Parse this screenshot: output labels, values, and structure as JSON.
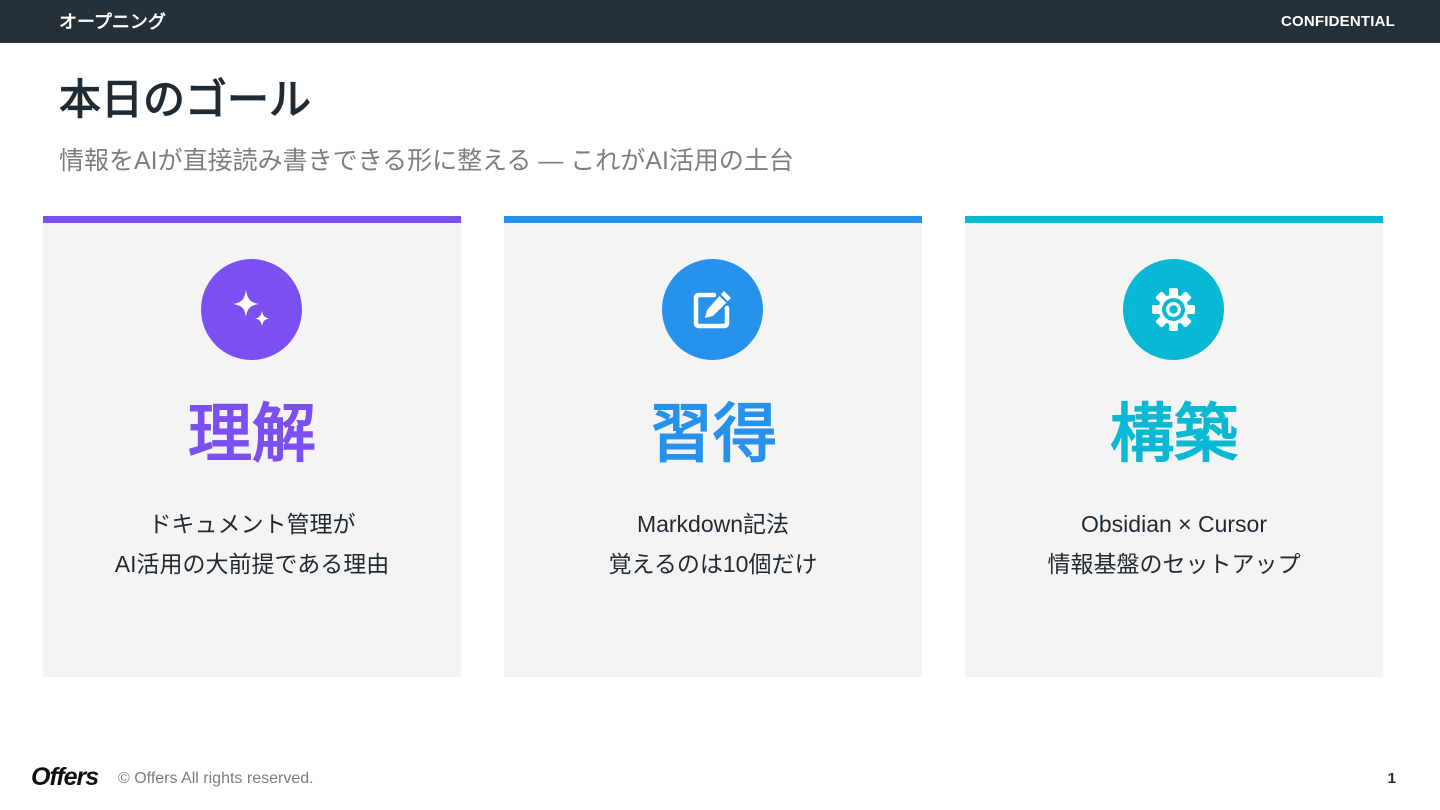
{
  "header": {
    "section": "オープニング",
    "label": "CONFIDENTIAL"
  },
  "title": "本日のゴール",
  "subtitle": "情報をAIが直接読み書きできる形に整える — これがAI活用の土台",
  "cards": [
    {
      "icon": "sparkles-icon",
      "color": "#7c4ff0",
      "heading": "理解",
      "lines": [
        "ドキュメント管理が",
        "AI活用の大前提である理由"
      ]
    },
    {
      "icon": "edit-icon",
      "color": "#2792ec",
      "heading": "習得",
      "lines": [
        "Markdown記法",
        "覚えるのは10個だけ"
      ]
    },
    {
      "icon": "gear-icon",
      "color": "#07b9d4",
      "heading": "構築",
      "lines": [
        "Obsidian × Cursor",
        "情報基盤のセットアップ"
      ]
    }
  ],
  "footer": {
    "logo": "Offers",
    "copyright": "© Offers All rights reserved.",
    "page": "1"
  }
}
